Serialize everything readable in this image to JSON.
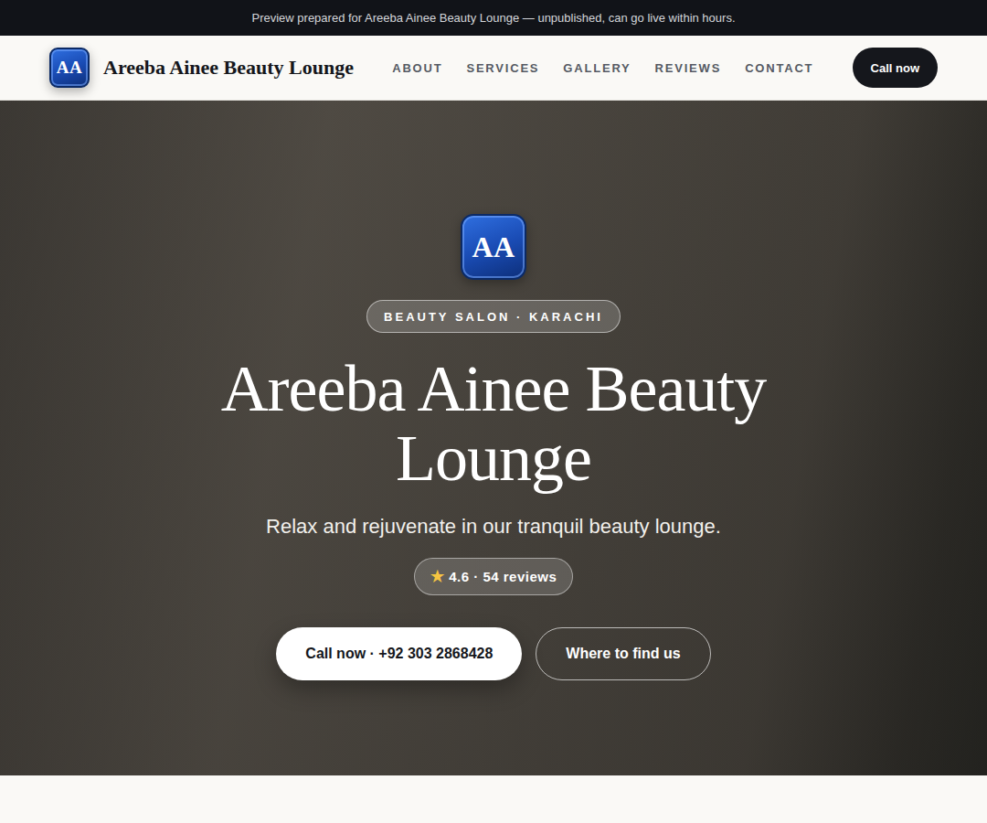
{
  "banner": {
    "text": "Preview prepared for Areeba Ainee Beauty Lounge — unpublished, can go live within hours."
  },
  "nav": {
    "logo": "AA",
    "brand": "Areeba Ainee Beauty Lounge",
    "links": [
      {
        "label": "ABOUT"
      },
      {
        "label": "SERVICES"
      },
      {
        "label": "GALLERY"
      },
      {
        "label": "REVIEWS"
      },
      {
        "label": "CONTACT"
      }
    ],
    "cta": "Call now"
  },
  "hero": {
    "logo": "AA",
    "badge": "BEAUTY SALON · KARACHI",
    "title": "Areeba Ainee Beauty Lounge",
    "subtitle": "Relax and rejuvenate in our tranquil beauty lounge.",
    "rating": {
      "icon": "★",
      "text": "4.6 · 54 reviews"
    },
    "buttons": [
      {
        "label": "Call now · +92 303 2868428",
        "kind": "primary"
      },
      {
        "label": "Where to find us",
        "kind": "secondary"
      }
    ]
  }
}
